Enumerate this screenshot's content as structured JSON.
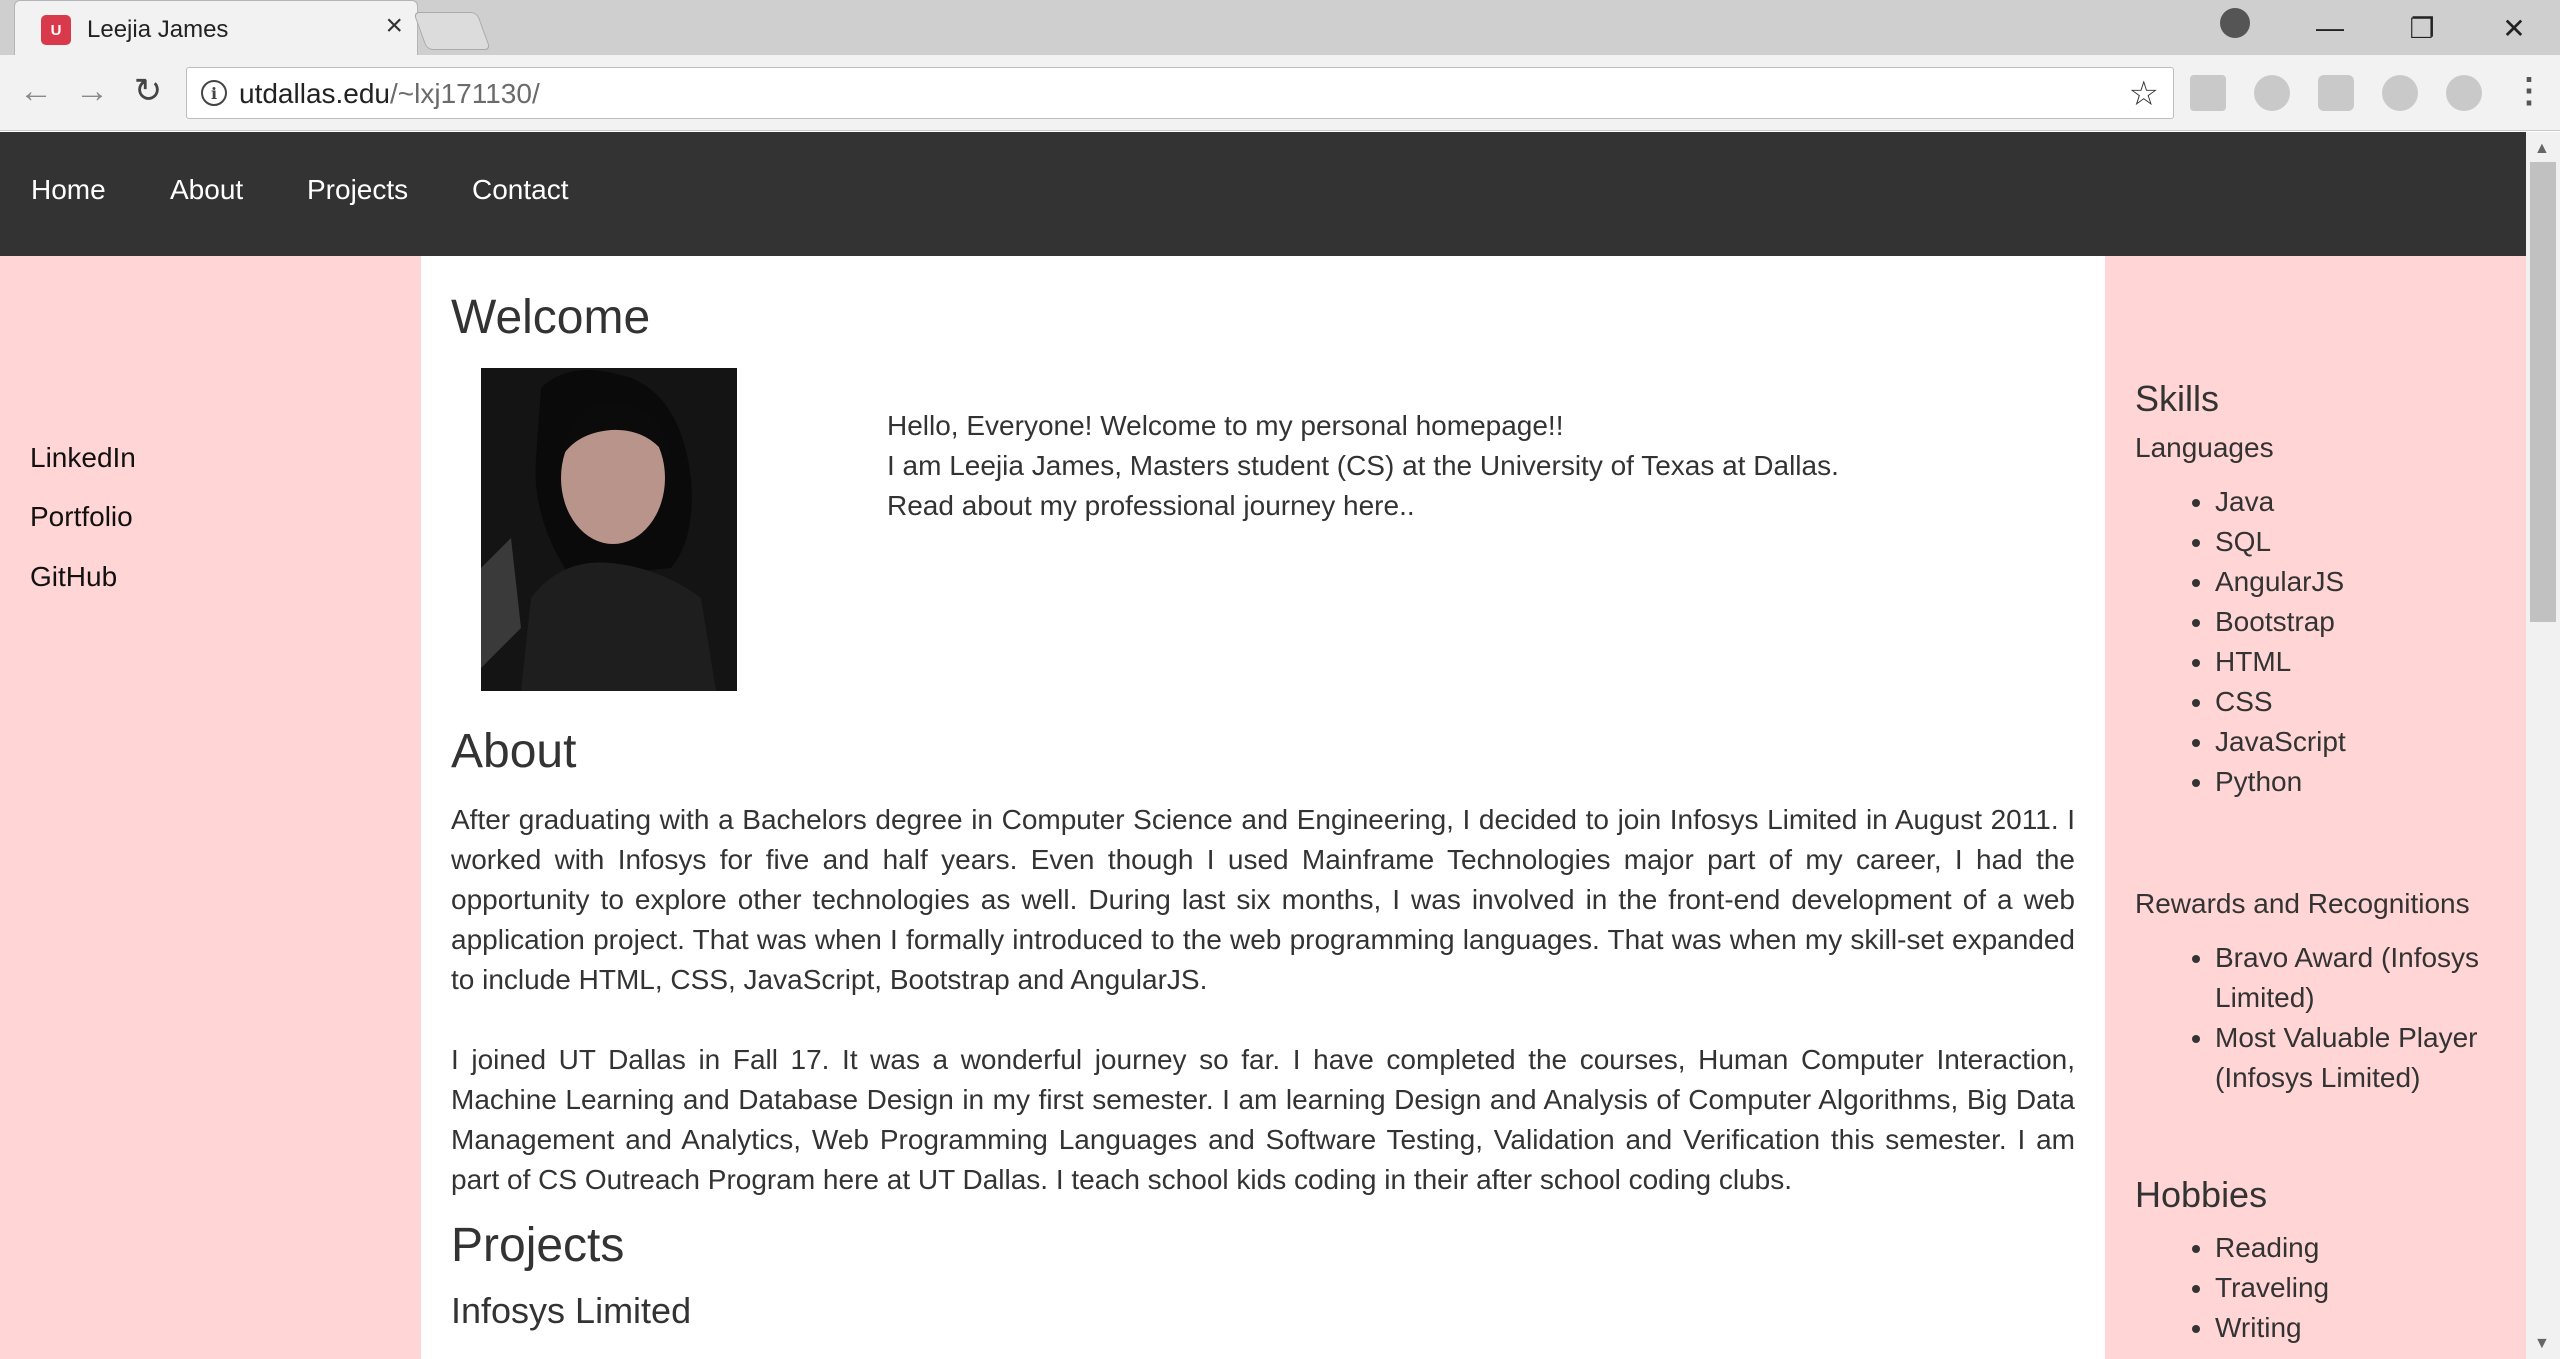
{
  "browser": {
    "tab_title": "Leejia James",
    "tab_close": "×",
    "favicon_text": "U",
    "url_host": "utdallas.edu",
    "url_path": "/~lxj171130/",
    "info_glyph": "i",
    "star_glyph": "☆",
    "back_glyph": "←",
    "forward_glyph": "→",
    "reload_glyph": "↻",
    "minimize_glyph": "—",
    "restore_glyph": "❐",
    "close_glyph": "✕",
    "menu_glyph": "⋮"
  },
  "nav": {
    "items": [
      "Home",
      "About",
      "Projects",
      "Contact"
    ]
  },
  "sidebar": {
    "links": [
      "LinkedIn",
      "Portfolio",
      "GitHub"
    ]
  },
  "main": {
    "welcome_heading": "Welcome",
    "welcome_lines": [
      "Hello, Everyone! Welcome to my personal homepage!!",
      "I am Leejia James, Masters student (CS) at the University of Texas at Dallas.",
      "Read about my professional journey here.."
    ],
    "about_heading": "About",
    "about_paragraphs": [
      "After graduating with a Bachelors degree in Computer Science and Engineering, I decided to join Infosys Limited in August 2011. I worked with Infosys for five and half years. Even though I used Mainframe Technologies major part of my career, I had the opportunity to explore other technologies as well. During last six months, I was involved in the front-end development of a web application project. That was when I formally introduced to the web programming languages. That was when my skill-set expanded to include HTML, CSS, JavaScript, Bootstrap and AngularJS.",
      "I joined UT Dallas in Fall 17. It was a wonderful journey so far. I have completed the courses, Human Computer Interaction, Machine Learning and Database Design in my first semester. I am learning Design and Analysis of Computer Algorithms, Big Data Management and Analytics, Web Programming Languages and Software Testing, Validation and Verification this semester. I am part of CS Outreach Program here at UT Dallas. I teach school kids coding in their after school coding clubs."
    ],
    "projects_heading": "Projects",
    "projects_sub": "Infosys Limited"
  },
  "aside": {
    "skills_heading": "Skills",
    "languages_label": "Languages",
    "languages": [
      "Java",
      "SQL",
      "AngularJS",
      "Bootstrap",
      "HTML",
      "CSS",
      "JavaScript",
      "Python"
    ],
    "rewards_label": "Rewards and Recognitions",
    "rewards": [
      "Bravo Award (Infosys Limited)",
      "Most Valuable Player (Infosys Limited)"
    ],
    "hobbies_heading": "Hobbies",
    "hobbies": [
      "Reading",
      "Traveling",
      "Writing"
    ]
  },
  "colors": {
    "nav_bg": "#333333",
    "side_bg": "#ffd5d5",
    "text": "#333333"
  }
}
